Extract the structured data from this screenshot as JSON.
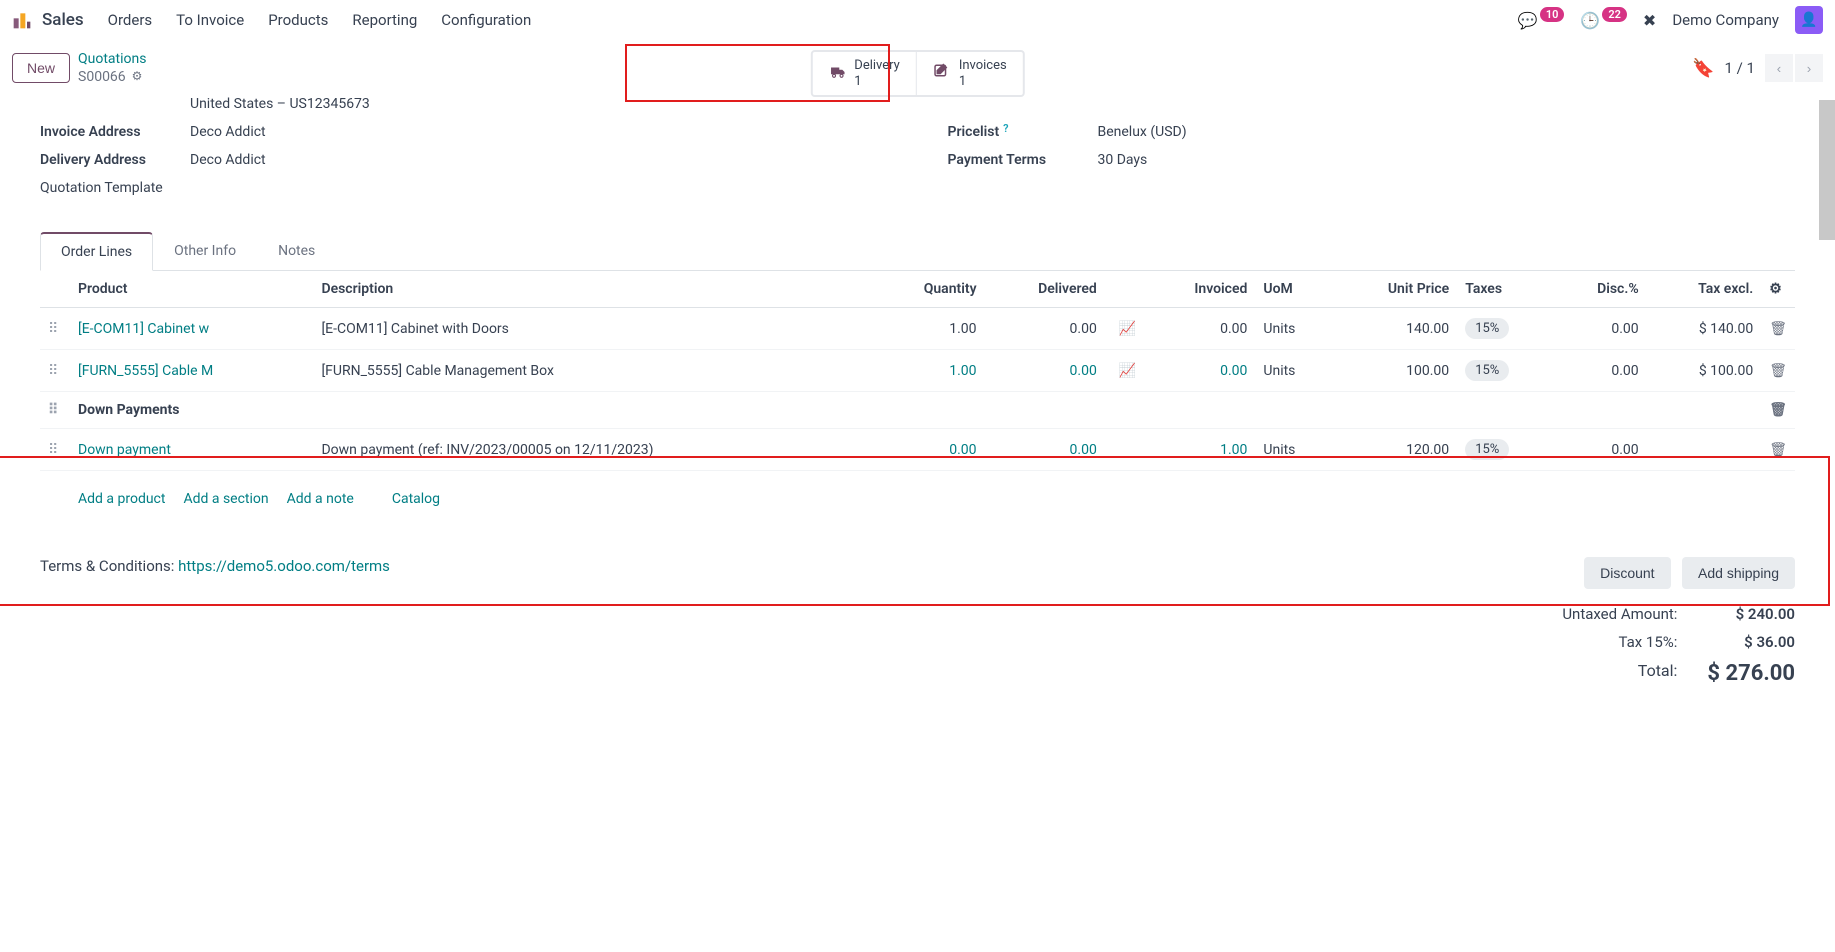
{
  "app_title": "Sales",
  "nav": [
    "Orders",
    "To Invoice",
    "Products",
    "Reporting",
    "Configuration"
  ],
  "msg_badge": "10",
  "clock_badge": "22",
  "company": "Demo Company",
  "breadcrumb": {
    "new": "New",
    "top": "Quotations",
    "current": "S00066"
  },
  "stat_pills": {
    "delivery_label": "Delivery",
    "delivery_count": "1",
    "invoices_label": "Invoices",
    "invoices_count": "1"
  },
  "pager": "1 / 1",
  "form": {
    "prev_line": "United States – US12345673",
    "invoice_addr_label": "Invoice Address",
    "invoice_addr": "Deco Addict",
    "delivery_addr_label": "Delivery Address",
    "delivery_addr": "Deco Addict",
    "quotation_tpl_label": "Quotation Template",
    "pricelist_label": "Pricelist",
    "pricelist": "Benelux (USD)",
    "payment_terms_label": "Payment Terms",
    "payment_terms": "30 Days"
  },
  "tabs": [
    "Order Lines",
    "Other Info",
    "Notes"
  ],
  "columns": {
    "product": "Product",
    "description": "Description",
    "quantity": "Quantity",
    "delivered": "Delivered",
    "invoiced": "Invoiced",
    "uom": "UoM",
    "unit_price": "Unit Price",
    "taxes": "Taxes",
    "disc": "Disc.%",
    "tax_excl": "Tax excl."
  },
  "rows": [
    {
      "product": "[E-COM11] Cabinet w",
      "desc": "[E-COM11] Cabinet with Doors",
      "qty": "1.00",
      "delivered": "0.00",
      "invoiced": "0.00",
      "uom": "Units",
      "unit_price": "140.00",
      "tax": "15%",
      "disc": "0.00",
      "excl": "$ 140.00",
      "link_qty": false,
      "link_inv": false,
      "graph": true
    },
    {
      "product": "[FURN_5555] Cable M",
      "desc": "[FURN_5555] Cable Management Box",
      "qty": "1.00",
      "delivered": "0.00",
      "invoiced": "0.00",
      "uom": "Units",
      "unit_price": "100.00",
      "tax": "15%",
      "disc": "0.00",
      "excl": "$ 100.00",
      "link_qty": true,
      "link_inv": true,
      "graph": true
    }
  ],
  "section": {
    "title": "Down Payments"
  },
  "down_row": {
    "product": "Down payment",
    "desc": "Down payment (ref: INV/2023/00005 on 12/11/2023)",
    "qty": "0.00",
    "delivered": "0.00",
    "invoiced": "1.00",
    "uom": "Units",
    "unit_price": "120.00",
    "tax": "15%",
    "disc": "0.00",
    "excl": ""
  },
  "add_links": {
    "product": "Add a product",
    "section": "Add a section",
    "note": "Add a note",
    "catalog": "Catalog"
  },
  "bottom": {
    "terms_label": "Terms & Conditions: ",
    "terms_link": "https://demo5.odoo.com/terms",
    "discount_btn": "Discount",
    "shipping_btn": "Add shipping",
    "untaxed_label": "Untaxed Amount:",
    "untaxed": "$ 240.00",
    "tax_label": "Tax 15%:",
    "tax": "$ 36.00",
    "total_label": "Total:",
    "total": "$ 276.00"
  }
}
